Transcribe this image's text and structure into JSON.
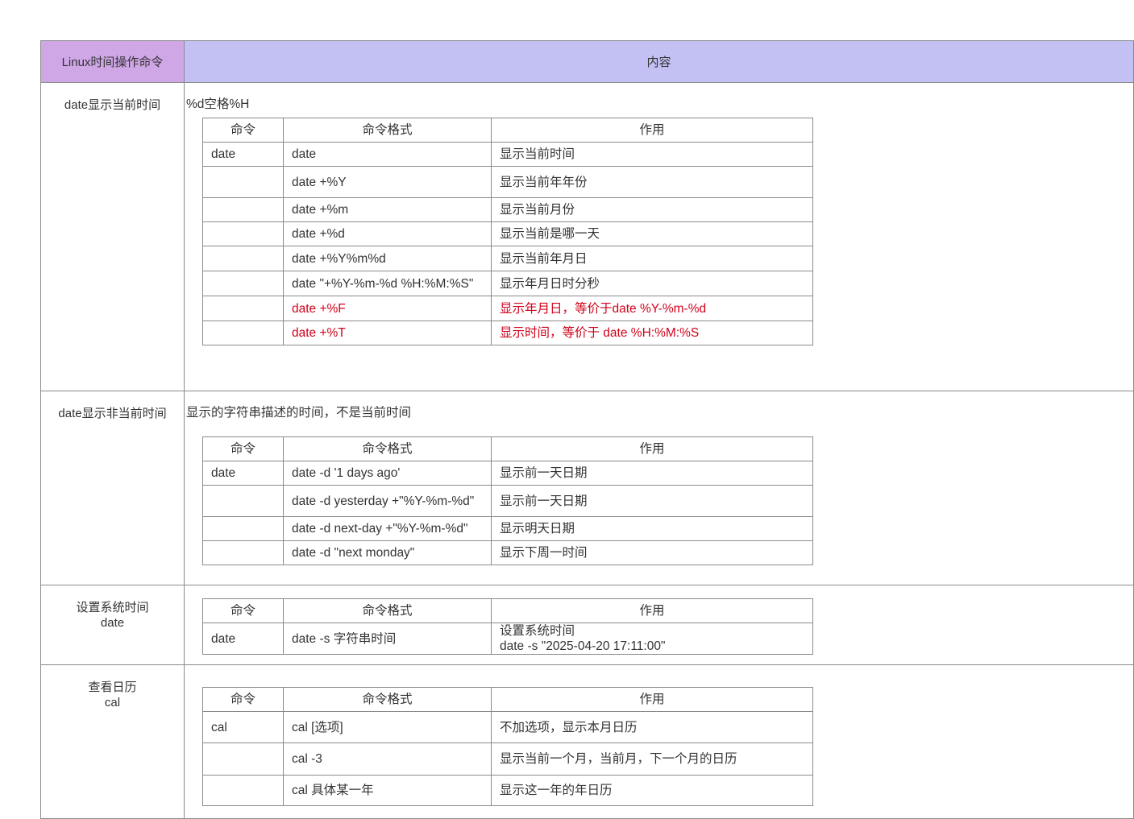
{
  "header": {
    "col1": "Linux时间操作命令",
    "col2": "内容"
  },
  "colors": {
    "header_left": "#cfa6e6",
    "header_right": "#c3c0f3",
    "highlight": "#d0021b"
  },
  "inner_headers": {
    "cmd": "命令",
    "format": "命令格式",
    "use": "作用"
  },
  "sections": [
    {
      "label": "date显示当前时间",
      "desc": "%d空格%H",
      "rows": [
        {
          "cmd": "date",
          "format": "date",
          "use": "显示当前时间"
        },
        {
          "cmd": "",
          "format": "date +%Y",
          "use": "显示当前年年份"
        },
        {
          "cmd": "",
          "format": "date +%m",
          "use": "显示当前月份"
        },
        {
          "cmd": "",
          "format": "date +%d",
          "use": "显示当前是哪一天"
        },
        {
          "cmd": "",
          "format": "date +%Y%m%d",
          "use": "显示当前年月日"
        },
        {
          "cmd": "",
          "format": "date \"+%Y-%m-%d %H:%M:%S\"",
          "use": "显示年月日时分秒"
        },
        {
          "cmd": "",
          "format": "date +%F",
          "use": "显示年月日，等价于date %Y-%m-%d"
        },
        {
          "cmd": "",
          "format": "date +%T",
          "use": "显示时间，等价于 date %H:%M:%S"
        }
      ]
    },
    {
      "label": "date显示非当前时间",
      "desc": "显示的字符串描述的时间，不是当前时间",
      "rows": [
        {
          "cmd": "date",
          "format": "date -d '1 days ago'",
          "use": "显示前一天日期"
        },
        {
          "cmd": "",
          "format": "date -d yesterday +\"%Y-%m-%d\"",
          "use": "显示前一天日期"
        },
        {
          "cmd": "",
          "format": "date -d next-day +\"%Y-%m-%d\"",
          "use": "显示明天日期"
        },
        {
          "cmd": "",
          "format": "date -d \"next monday\"",
          "use": "显示下周一时间"
        }
      ]
    },
    {
      "label_line1": "设置系统时间",
      "label_line2": "date",
      "rows": [
        {
          "cmd": "date",
          "format": "date -s 字符串时间",
          "use_line1": "设置系统时间",
          "use_line2": "date -s \"2025-04-20 17:11:00\""
        }
      ]
    },
    {
      "label_line1": "查看日历",
      "label_line2": "cal",
      "rows": [
        {
          "cmd": "cal",
          "format": "cal [选项]",
          "use": "不加选项，显示本月日历"
        },
        {
          "cmd": "",
          "format": "cal -3",
          "use": "显示当前一个月，当前月，下一个月的日历"
        },
        {
          "cmd": "",
          "format": "cal 具体某一年",
          "use": "显示这一年的年日历"
        }
      ]
    }
  ]
}
